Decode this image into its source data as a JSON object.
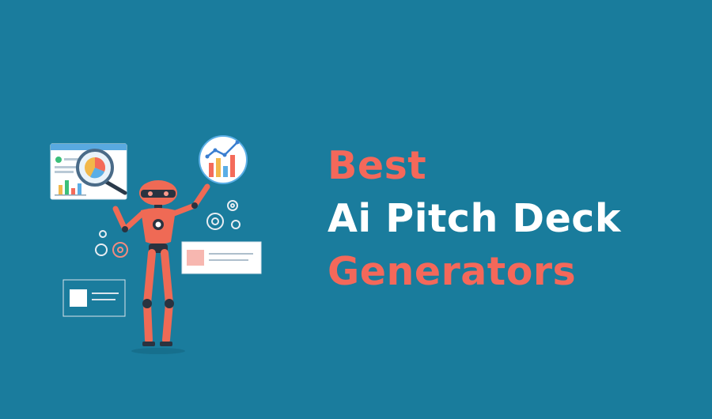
{
  "headline": {
    "line1": "Best",
    "line2": "Ai Pitch Deck",
    "line3": "Generators"
  },
  "colors": {
    "background": "#1a7c9d",
    "accent": "#f4685a",
    "highlight_text": "#ffffff",
    "robot_body": "#ef6a55",
    "robot_joints": "#1f2a36"
  },
  "illustration": {
    "subject": "robot-presenting-charts",
    "icons": [
      "analytics-window-icon",
      "magnifier-icon",
      "pie-chart-icon",
      "bar-chart-icon",
      "line-chart-icon",
      "gear-icon",
      "document-card-icon"
    ]
  }
}
